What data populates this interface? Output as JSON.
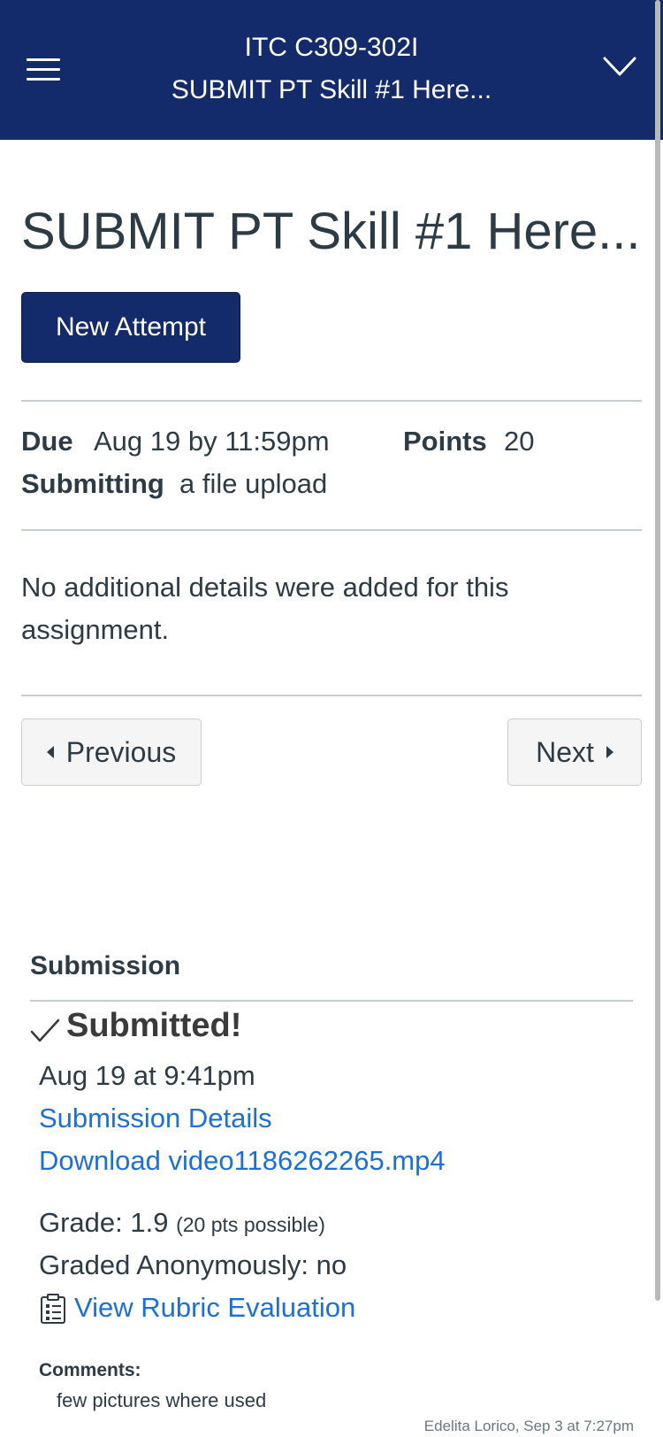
{
  "header": {
    "course": "ITC C309-302I",
    "assignment": "SUBMIT PT Skill #1 Here..."
  },
  "page_title": "SUBMIT PT Skill #1 Here...",
  "new_attempt_label": "New Attempt",
  "details": {
    "due_label": "Due",
    "due_value": "Aug 19 by 11:59pm",
    "points_label": "Points",
    "points_value": "20",
    "submitting_label": "Submitting",
    "submitting_value": "a file upload"
  },
  "description": "No additional details were added for this assignment.",
  "nav": {
    "previous": "Previous",
    "next": "Next"
  },
  "submission": {
    "heading": "Submission",
    "status": "Submitted!",
    "date": "Aug 19 at 9:41pm",
    "details_link": "Submission Details",
    "download_link": "Download video1186262265.mp4",
    "grade_label": "Grade: 1.9",
    "grade_possible": "(20 pts possible)",
    "anonymous": "Graded Anonymously: no",
    "rubric_link": "View Rubric Evaluation",
    "comments_label": "Comments:",
    "comment_text": "few pictures where used",
    "comment_meta": "Edelita Lorico, Sep 3 at 7:27pm"
  },
  "colors": {
    "header_bg": "#142b6b",
    "link": "#1d6fd8",
    "text": "#2d3b45"
  },
  "icons": [
    "hamburger-menu-icon",
    "chevron-down-icon",
    "caret-left-icon",
    "caret-right-icon",
    "checkmark-icon",
    "rubric-icon"
  ]
}
